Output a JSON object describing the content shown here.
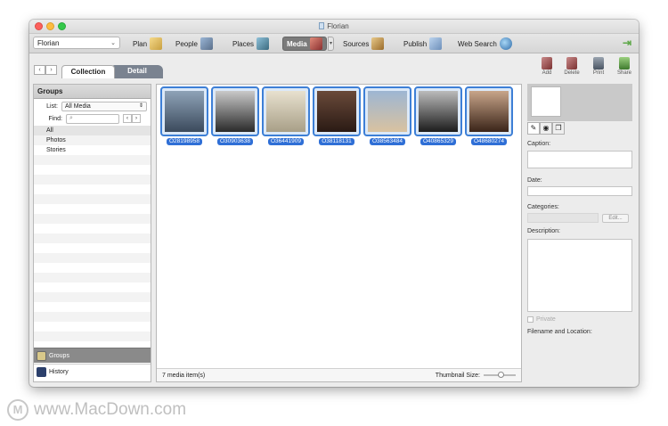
{
  "window": {
    "title": "Florian"
  },
  "toolbar": {
    "tree_selector": "Florian",
    "nav": [
      {
        "label": "Plan",
        "icon": "plan-icon"
      },
      {
        "label": "People",
        "icon": "people-icon"
      },
      {
        "label": "Places",
        "icon": "places-icon"
      },
      {
        "label": "Media",
        "icon": "media-icon",
        "active": true
      },
      {
        "label": "Sources",
        "icon": "sources-icon"
      },
      {
        "label": "Publish",
        "icon": "publish-icon"
      },
      {
        "label": "Web Search",
        "icon": "web-search-icon"
      }
    ]
  },
  "tabs": {
    "collection": "Collection",
    "detail": "Detail"
  },
  "actions": [
    {
      "label": "Add",
      "icon": "add-media-icon"
    },
    {
      "label": "Delete",
      "icon": "delete-media-icon"
    },
    {
      "label": "Print",
      "icon": "print-icon"
    },
    {
      "label": "Share",
      "icon": "share-icon"
    }
  ],
  "sidebar": {
    "title": "Groups",
    "list_label": "List:",
    "list_value": "All Media",
    "find_label": "Find:",
    "items": [
      "All",
      "Photos",
      "Stories"
    ],
    "footer_groups": "Groups",
    "footer_history": "History"
  },
  "media": {
    "items": [
      {
        "label": "O28198958"
      },
      {
        "label": "O30903638"
      },
      {
        "label": "O36441909"
      },
      {
        "label": "O38118131"
      },
      {
        "label": "O38563484"
      },
      {
        "label": "O40865329"
      },
      {
        "label": "O48680274"
      }
    ],
    "count": "7 media item(s)",
    "thumb_size_label": "Thumbnail Size:",
    "thumb_size_value": 0.55
  },
  "details": {
    "caption_label": "Caption:",
    "date_label": "Date:",
    "categories_label": "Categories:",
    "edit_button": "Edit...",
    "description_label": "Description:",
    "private_label": "Private",
    "filename_label": "Filename and Location:"
  },
  "watermark": {
    "text": "www.MacDown.com",
    "logo_letter": "M"
  },
  "colors": {
    "accent": "#2f6fd6",
    "selection_frame": "#3d7fd6"
  }
}
